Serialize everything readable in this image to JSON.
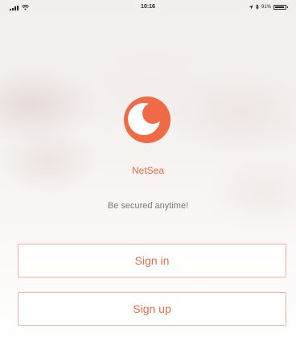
{
  "status_bar": {
    "time": "10:16",
    "battery_percent": "91%",
    "battery_level": 0.91
  },
  "app": {
    "name": "NetSea",
    "tagline": "Be secured anytime!",
    "brand_color": "#ee6b45"
  },
  "buttons": {
    "sign_in": "Sign in",
    "sign_up": "Sign up"
  },
  "icons": {
    "logo": "moon-eye-logo-icon",
    "signal": "cellular-signal-icon",
    "wifi": "wifi-icon",
    "location": "location-icon",
    "bluetooth": "bluetooth-icon",
    "battery": "battery-icon"
  }
}
